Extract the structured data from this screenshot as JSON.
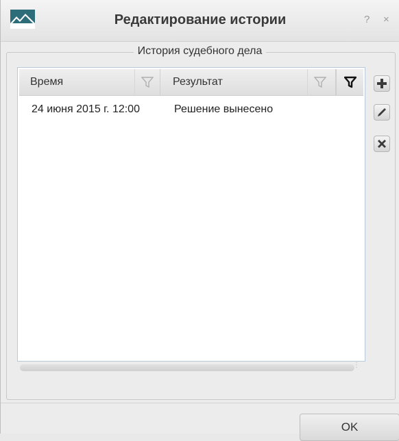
{
  "window": {
    "title": "Редактирование истории",
    "help_label": "?",
    "close_label": "×",
    "app_icon": "mountains-icon"
  },
  "group": {
    "legend": "История судебного дела"
  },
  "table": {
    "columns": [
      {
        "label": "Время",
        "filter_icon": "filter-icon"
      },
      {
        "label": "Результат",
        "filter_icon": "filter-icon"
      }
    ],
    "filter_all_icon": "filter-icon",
    "rows": [
      {
        "time": "24 июня 2015 г. 12:00",
        "result": "Решение вынесено"
      }
    ]
  },
  "side_buttons": [
    {
      "action": "add",
      "icon": "plus-icon"
    },
    {
      "action": "edit",
      "icon": "pencil-icon"
    },
    {
      "action": "delete",
      "icon": "x-icon"
    }
  ],
  "footer": {
    "ok_label": "OK"
  },
  "colors": {
    "window_bg": "#ececec",
    "table_border": "#b7c9da",
    "text": "#222222"
  }
}
